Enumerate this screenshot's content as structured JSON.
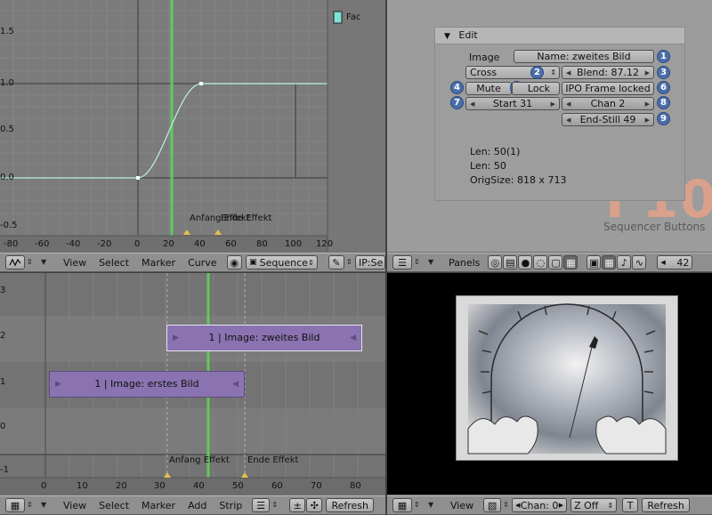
{
  "ipo_view": {
    "legend": "Fac",
    "y_ticks": [
      "1.5",
      "1.0",
      "0.5",
      "0.0",
      "-0.5"
    ],
    "x_ticks": [
      "-80",
      "-60",
      "-40",
      "-20",
      "0",
      "20",
      "40",
      "60",
      "80",
      "100",
      "120"
    ],
    "marker_left": "Anfang Effekt",
    "marker_right": "Ende Effekt",
    "curve_color": "#b8f2e6",
    "header": {
      "menus": [
        "View",
        "Select",
        "Marker",
        "Curve"
      ],
      "type_select": "Sequence",
      "ipo_select": "IP:Se"
    }
  },
  "buttons_view": {
    "panel_title": "Edit",
    "image_label": "Image",
    "name_field": "Name: zweites Bild",
    "effect_select": "Cross",
    "blend_field": "Blend: 87.12",
    "mute_btn": "Mute",
    "lock_btn": "Lock",
    "ipo_frame_btn": "IPO Frame locked",
    "start_field": "Start 31",
    "chan_field": "Chan 2",
    "endstill_field": "End-Still 49",
    "badges": [
      "1",
      "2",
      "3",
      "4",
      "5",
      "6",
      "7",
      "8",
      "9"
    ],
    "info": [
      "Len: 50(1)",
      "Len: 50",
      "OrigSize: 818 x 713"
    ],
    "watermark_key": "F10",
    "watermark_caption": "Sequencer Buttons",
    "header": {
      "panels_label": "Panels",
      "frame_field": "42"
    }
  },
  "sequence_view": {
    "y_ticks": [
      "3",
      "2",
      "1",
      "0",
      "-1"
    ],
    "x_ticks": [
      "0",
      "10",
      "20",
      "30",
      "40",
      "50",
      "60",
      "70",
      "80"
    ],
    "strip_top": "1 | Image: zweites Bild",
    "strip_bottom": "1 | Image: erstes Bild",
    "marker_left": "Anfang Effekt",
    "marker_right": "Ende Effekt",
    "header": {
      "menus": [
        "View",
        "Select",
        "Marker",
        "Add",
        "Strip"
      ],
      "refresh": "Refresh"
    }
  },
  "preview_view": {
    "header": {
      "menus": [
        "View"
      ],
      "chan_field": "Chan: 0",
      "zoff_select": "Z Off",
      "t_btn": "T",
      "refresh": "Refresh"
    }
  }
}
